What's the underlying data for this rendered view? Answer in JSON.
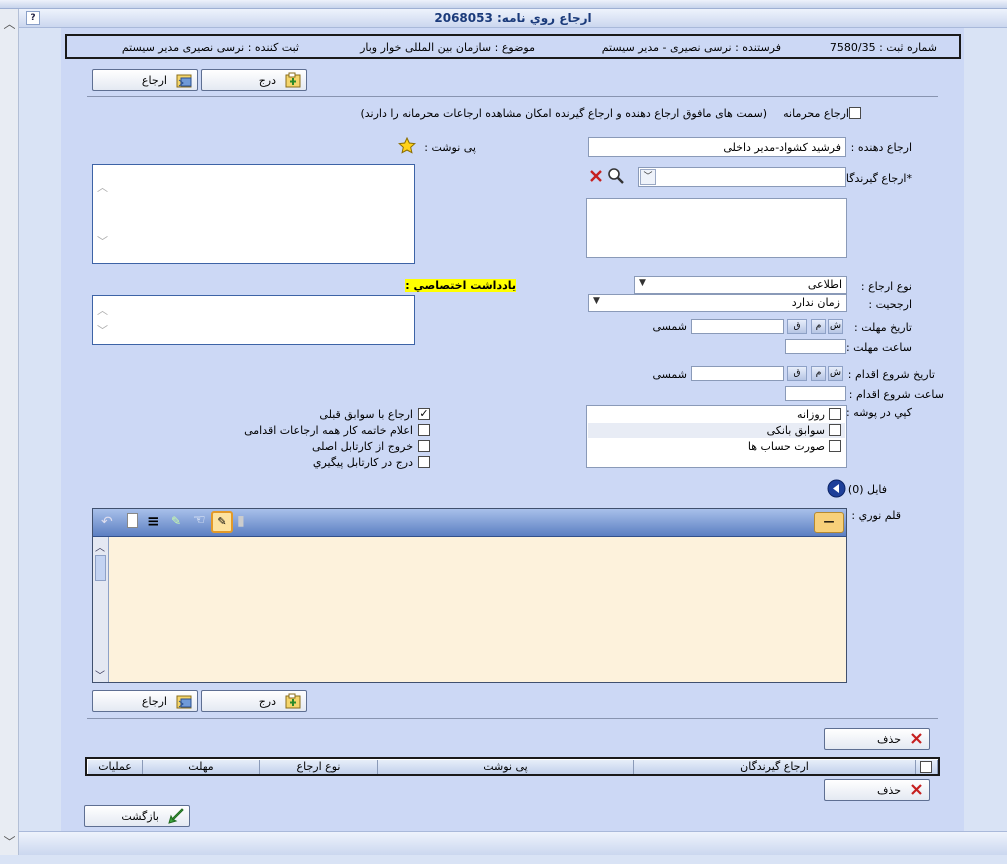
{
  "window": {
    "title": "ارجاع روي نامه: 2068053",
    "help_label": "?"
  },
  "info": {
    "record_no": "شماره ثبت : 7580/35",
    "sender": "فرستنده : نرسی نصیری - مدیر سیستم",
    "subject": "موضوع : سازمان بین المللی خوار وبار",
    "registrar": "ثبت کننده : نرسی نصیری مدیر سیستم"
  },
  "toolbar": {
    "insert_label": "درج",
    "refer_label": "ارجاع"
  },
  "form": {
    "confidential_label": "ارجاع محرمانه",
    "confidential_note": "(سمت های مافوق ارجاع دهنده و ارجاع گیرنده امکان مشاهده ارجاعات محرمانه را دارند)",
    "referrer_label": "ارجاع دهنده :",
    "referrer_value": "فرشید کشواد-مدیر داخلی",
    "recipients_label": "*ارجاع گیرندگان :",
    "footnote_label": "پی نوشت :",
    "referral_type_label": "نوع ارجاع :",
    "referral_type_value": "اطلاعی",
    "priority_label": "ارجحیت :",
    "priority_value": "زمان ندارد",
    "deadline_date_label": "تاریخ مهلت :",
    "deadline_time_label": "ساعت مهلت :",
    "start_date_label": "تاریخ شروع اقدام :",
    "start_time_label": "ساعت شروع اقدام :",
    "calendar_label": "شمسی",
    "date_buttons": [
      "ش",
      "م",
      "ق"
    ],
    "private_note_label": "يادداشت اختصاصي :",
    "copy_folder_label": "کپي در پوشه :",
    "folders": [
      "روزانه",
      "سوابق بانکی",
      "صورت حساب ها"
    ],
    "options": [
      {
        "label": "ارجاع با سوابق قبلی",
        "checked": true
      },
      {
        "label": "اعلام خاتمه کار همه ارجاعات اقدامی",
        "checked": false
      },
      {
        "label": "خروج از کارتابل اصلی",
        "checked": false
      },
      {
        "label": "درج در کارتابل پيگيري",
        "checked": false
      }
    ],
    "file_label": "فايل (0)",
    "pen_label": "قلم نوري :"
  },
  "table": {
    "delete_label": "حذف",
    "columns": [
      "ارجاع گیرندگان",
      "پی نوشت",
      "نوع ارجاع",
      "مهلت",
      "عملیات"
    ]
  },
  "back_label": "بازگشت",
  "colors": {
    "accent": "#1a3a7a",
    "panel": "#ccd8f5",
    "editor_bg": "#fdf2dc",
    "highlight": "#ffff00"
  }
}
